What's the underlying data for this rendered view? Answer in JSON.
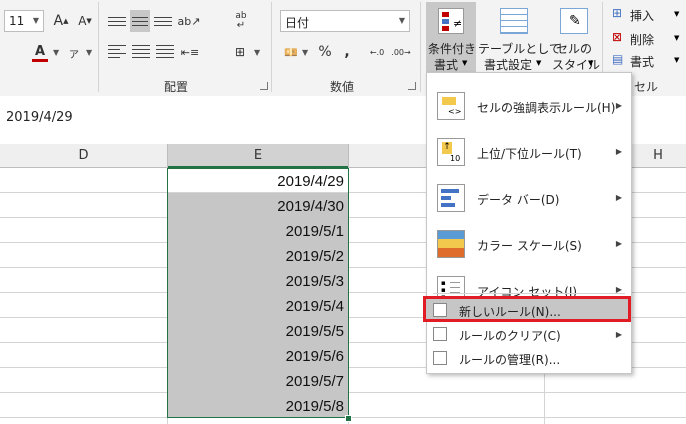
{
  "font": {
    "size": "11"
  },
  "number_format": {
    "value": "日付"
  },
  "groups": {
    "alignment": "配置",
    "number": "数値",
    "cells_partial": "セル"
  },
  "ribbon": {
    "percent": "%",
    "comma": ",",
    "cond_format_line1": "条件付き",
    "cond_format_line2": "書式",
    "table_format_line1": "テーブルとして",
    "table_format_line2": "書式設定",
    "cell_style_line1": "セルの",
    "cell_style_line2": "スタイル",
    "insert": "挿入",
    "delete": "削除",
    "format": "書式",
    "wrap_icon_text": "ab"
  },
  "formula_bar": {
    "value": "2019/4/29"
  },
  "columns": [
    "D",
    "E",
    "H"
  ],
  "cells": [
    "2019/4/29",
    "2019/4/30",
    "2019/5/1",
    "2019/5/2",
    "2019/5/3",
    "2019/5/4",
    "2019/5/5",
    "2019/5/6",
    "2019/5/7",
    "2019/5/8"
  ],
  "menu": {
    "items": [
      "セルの強調表示ルール(H)",
      "上位/下位ルール(T)",
      "データ バー(D)",
      "カラー スケール(S)",
      "アイコン セット(I)"
    ],
    "small_items": [
      "新しいルール(N)...",
      "ルールのクリア(C)",
      "ルールの管理(R)..."
    ],
    "highlight_color": "#e11c24"
  },
  "colors": {
    "selection": "#c6c6c6",
    "grid_border": "#217346",
    "alert": "#c00000"
  }
}
